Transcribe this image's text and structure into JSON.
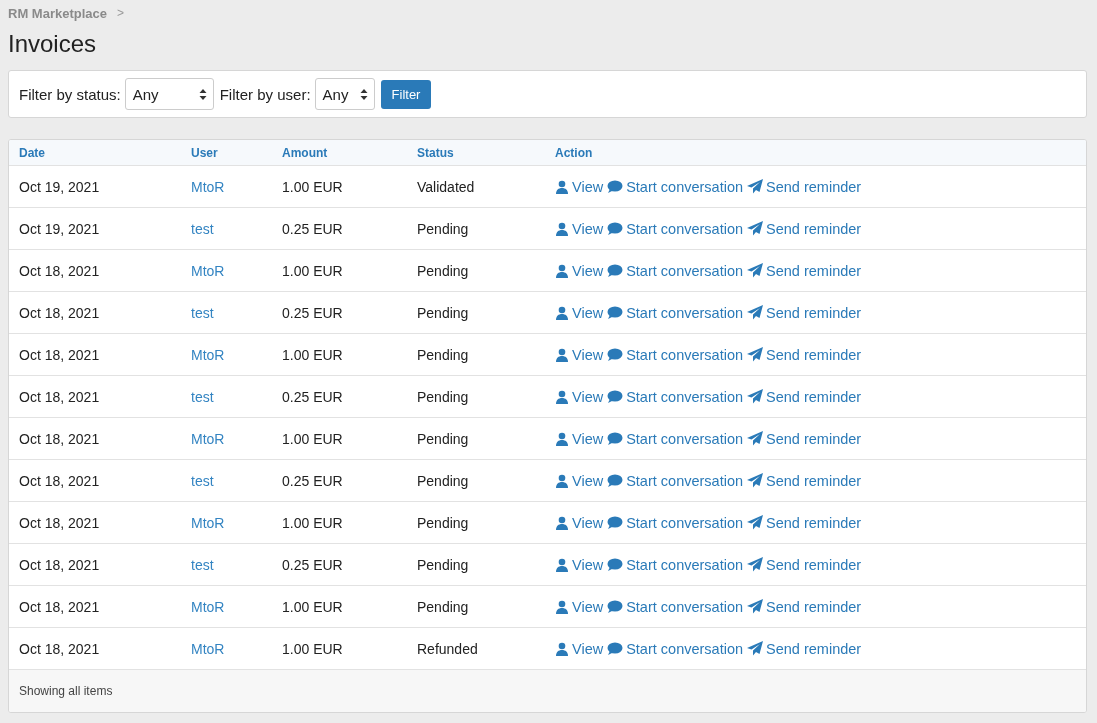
{
  "breadcrumb": {
    "items": [
      "RM Marketplace"
    ],
    "separator": ">"
  },
  "title": "Invoices",
  "filters": [
    {
      "label": "Filter by status:",
      "value": "Any"
    },
    {
      "label": "Filter by user:",
      "value": "Any"
    }
  ],
  "filter_button": "Filter",
  "table": {
    "columns": [
      "Date",
      "User",
      "Amount",
      "Status",
      "Action"
    ],
    "rows": [
      {
        "date": "Oct 19, 2021",
        "user": "MtoR",
        "amount": "1.00 EUR",
        "status": "Validated",
        "actions": [
          "View",
          "Start conversation",
          "Send reminder"
        ]
      },
      {
        "date": "Oct 19, 2021",
        "user": "test",
        "amount": "0.25 EUR",
        "status": "Pending",
        "actions": [
          "View",
          "Start conversation",
          "Send reminder"
        ]
      },
      {
        "date": "Oct 18, 2021",
        "user": "MtoR",
        "amount": "1.00 EUR",
        "status": "Pending",
        "actions": [
          "View",
          "Start conversation",
          "Send reminder"
        ]
      },
      {
        "date": "Oct 18, 2021",
        "user": "test",
        "amount": "0.25 EUR",
        "status": "Pending",
        "actions": [
          "View",
          "Start conversation",
          "Send reminder"
        ]
      },
      {
        "date": "Oct 18, 2021",
        "user": "MtoR",
        "amount": "1.00 EUR",
        "status": "Pending",
        "actions": [
          "View",
          "Start conversation",
          "Send reminder"
        ]
      },
      {
        "date": "Oct 18, 2021",
        "user": "test",
        "amount": "0.25 EUR",
        "status": "Pending",
        "actions": [
          "View",
          "Start conversation",
          "Send reminder"
        ]
      },
      {
        "date": "Oct 18, 2021",
        "user": "MtoR",
        "amount": "1.00 EUR",
        "status": "Pending",
        "actions": [
          "View",
          "Start conversation",
          "Send reminder"
        ]
      },
      {
        "date": "Oct 18, 2021",
        "user": "test",
        "amount": "0.25 EUR",
        "status": "Pending",
        "actions": [
          "View",
          "Start conversation",
          "Send reminder"
        ]
      },
      {
        "date": "Oct 18, 2021",
        "user": "MtoR",
        "amount": "1.00 EUR",
        "status": "Pending",
        "actions": [
          "View",
          "Start conversation",
          "Send reminder"
        ]
      },
      {
        "date": "Oct 18, 2021",
        "user": "test",
        "amount": "0.25 EUR",
        "status": "Pending",
        "actions": [
          "View",
          "Start conversation",
          "Send reminder"
        ]
      },
      {
        "date": "Oct 18, 2021",
        "user": "MtoR",
        "amount": "1.00 EUR",
        "status": "Pending",
        "actions": [
          "View",
          "Start conversation",
          "Send reminder"
        ]
      },
      {
        "date": "Oct 18, 2021",
        "user": "MtoR",
        "amount": "1.00 EUR",
        "status": "Refunded",
        "actions": [
          "View",
          "Start conversation",
          "Send reminder"
        ]
      }
    ],
    "footer": "Showing all items"
  }
}
